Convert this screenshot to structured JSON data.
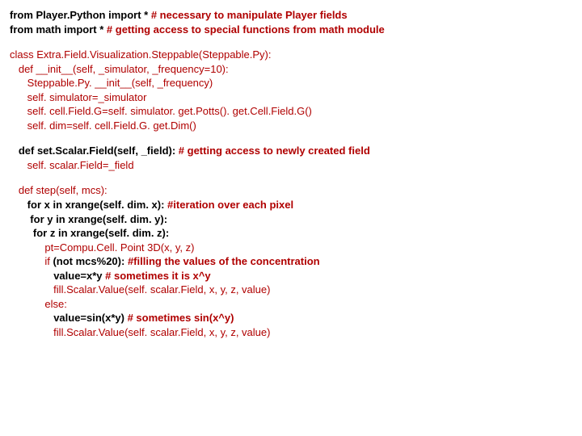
{
  "block1": [
    {
      "bold": true,
      "text": "from Player.Python import * ",
      "comment": "# necessary to manipulate Player fields"
    },
    {
      "bold": true,
      "text": "from math import * ",
      "comment": "# getting access to special functions from math module"
    }
  ],
  "block2": [
    "class Extra.Field.Visualization.Steppable(Steppable.Py):",
    "   def __init__(self, _simulator, _frequency=10):",
    "      Steppable.Py. __init__(self, _frequency)",
    "      self. simulator=_simulator",
    "      self. cell.Field.G=self. simulator. get.Potts(). get.Cell.Field.G()",
    "      self. dim=self. cell.Field.G. get.Dim()"
  ],
  "block3": {
    "lead": "   def set.Scalar.Field(self, _field): ",
    "comment": "# getting access to newly created field",
    "body": "      self. scalar.Field=_field"
  },
  "block4": [
    {
      "pre": "   def step(self, mcs):",
      "comment": ""
    },
    {
      "pre": "      ",
      "bold": "for x in xrange(self. dim. x): ",
      "comment": "#iteration over each pixel"
    },
    {
      "pre": "       ",
      "bold": "for y in xrange(self. dim. y):",
      "comment": ""
    },
    {
      "pre": "        ",
      "bold": "for z in xrange(self. dim. z):",
      "comment": ""
    },
    {
      "pre": "            pt=Compu.Cell. Point 3D(x, y, z)",
      "comment": ""
    },
    {
      "pre": "            if ",
      "bold": "(not mcs%20): ",
      "comment": "#filling the values of the concentration"
    },
    {
      "pre": "               ",
      "bold": "value=x*y ",
      "comment": "# sometimes it is x^y"
    },
    {
      "pre": "               fill.Scalar.Value(self. scalar.Field, x, y, z, value)",
      "comment": ""
    },
    {
      "pre": "            else:",
      "comment": ""
    },
    {
      "pre": "               ",
      "bold": "value=sin(x*y) ",
      "comment": "# sometimes sin(x^y)"
    },
    {
      "pre": "               fill.Scalar.Value(self. scalar.Field, x, y, z, value)",
      "comment": ""
    }
  ]
}
